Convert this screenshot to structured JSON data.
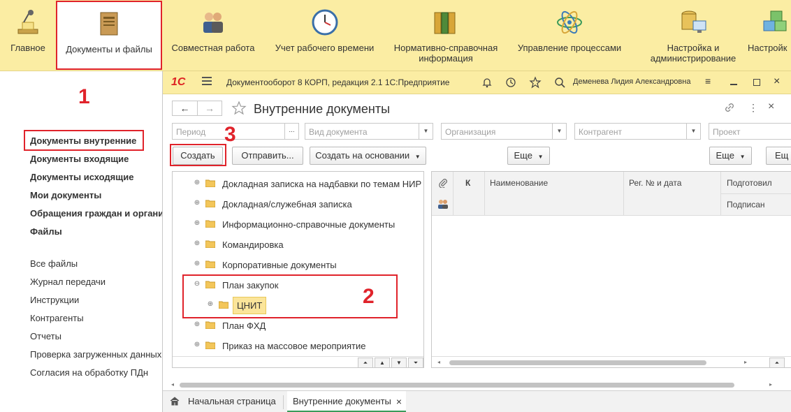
{
  "sections": [
    {
      "label": "Главное",
      "icon": "desk-lamp-icon"
    },
    {
      "label": "Документы и файлы",
      "icon": "document-folder-icon"
    },
    {
      "label": "Совместная работа",
      "icon": "people-icon"
    },
    {
      "label": "Учет рабочего времени",
      "icon": "clock-icon"
    },
    {
      "label": "Нормативно-справочная информация",
      "icon": "binders-icon"
    },
    {
      "label": "Управление процессами",
      "icon": "atom-icon"
    },
    {
      "label": "Настройка и администрирование",
      "icon": "database-computer-icon"
    },
    {
      "label": "Настройк",
      "icon": "cubes-icon"
    }
  ],
  "nav": {
    "bold_items": [
      "Документы внутренние",
      "Документы входящие",
      "Документы исходящие",
      "Мои документы",
      "Обращения граждан и органи",
      "Файлы"
    ],
    "items": [
      "Все файлы",
      "Журнал передачи",
      "Инструкции",
      "Контрагенты",
      "Отчеты",
      "Проверка загруженных данных",
      "Согласия на обработку ПДн"
    ]
  },
  "annotations": {
    "one": "1",
    "two": "2",
    "three": "3"
  },
  "window": {
    "logo": "1С",
    "title": "Документооборот 8 КОРП, редакция 2.1 1С:Предприятие",
    "user": "Деменева Лидия Александровна",
    "form_title": "Внутренние документы",
    "filters": {
      "period": "Период",
      "doc_type": "Вид документа",
      "org": "Организация",
      "contractor": "Контрагент",
      "project": "Проект"
    },
    "buttons": {
      "create": "Создать",
      "send": "Отправить...",
      "create_based": "Создать на основании",
      "more": "Еще",
      "more2": "Еще",
      "more3": "Ещ"
    },
    "tree": [
      "Докладная записка на надбавки по темам НИР",
      "Докладная/служебная записка",
      "Информационно-справочные документы",
      "Командировка",
      "Корпоративные документы",
      "План закупок",
      "ЦНИТ",
      "План ФХД",
      "Приказ на массовое мероприятие"
    ],
    "columns": {
      "k": "К",
      "name": "Наименование",
      "reg": "Рег. № и дата",
      "prepared": "Подготовил",
      "signed": "Подписан"
    },
    "tabs": {
      "home": "Начальная страница",
      "current": "Внутренние документы"
    }
  },
  "colors": {
    "panel": "#fbeda3",
    "annotation": "#e0232b",
    "highlight": "#fbe59a"
  }
}
